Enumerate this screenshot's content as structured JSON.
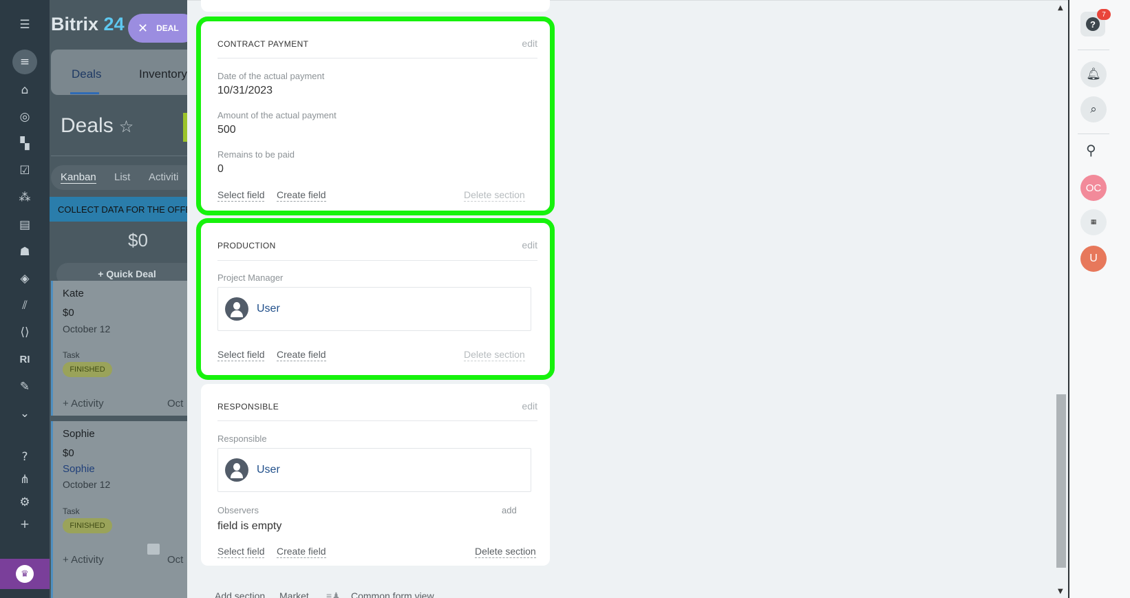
{
  "header": {
    "logo_word": "Bitrix",
    "logo_number": "24",
    "deal_pill_label": "DEAL"
  },
  "crm_tabs": {
    "deals": "Deals",
    "inventory": "Inventory"
  },
  "page_title": "Deals",
  "view_tabs": {
    "kanban": "Kanban",
    "list": "List",
    "activities": "Activiti"
  },
  "stage": {
    "label": "COLLECT DATA FOR THE OFFE",
    "sum": "$0",
    "quick_deal": "Quick Deal"
  },
  "cards": [
    {
      "name": "Kate",
      "amount": "$0",
      "date": "October 12",
      "task_label": "Task",
      "badge": "FINISHED",
      "activity": "+ Activity",
      "date_short": "Oct"
    },
    {
      "name": "Sophie",
      "amount": "$0",
      "contact": "Sophie",
      "date": "October 12",
      "task_label": "Task",
      "badge": "FINISHED",
      "activity": "+ Activity",
      "date_short": "Oct"
    }
  ],
  "rail": {
    "bottom_text": "RI"
  },
  "sections": {
    "contract_payment": {
      "title": "CONTRACT PAYMENT",
      "edit": "edit",
      "fields": [
        {
          "label": "Date of the actual payment",
          "value": "10/31/2023"
        },
        {
          "label": "Amount of the actual payment",
          "value": "500"
        },
        {
          "label": "Remains to be paid",
          "value": "0"
        }
      ],
      "select_field": "Select field",
      "create_field": "Create field",
      "delete_section": "Delete section"
    },
    "production": {
      "title": "PRODUCTION",
      "edit": "edit",
      "field_label": "Project Manager",
      "user_name": "User",
      "select_field": "Select field",
      "create_field": "Create field",
      "delete_section": "Delete section"
    },
    "responsible": {
      "title": "RESPONSIBLE",
      "edit": "edit",
      "field_label": "Responsible",
      "user_name": "User",
      "observers_label": "Observers",
      "observers_add": "add",
      "observers_value": "field is empty",
      "select_field": "Select field",
      "create_field": "Create field",
      "delete_section": "Delete section"
    }
  },
  "footer": {
    "add_section": "Add section",
    "market": "Market",
    "common_form_view": "Common form view"
  },
  "right_panel": {
    "help_count": "7",
    "avatar_oc": "OC",
    "avatar_u": "U"
  },
  "colors": {
    "highlight": "#16f20c",
    "rail": "#2c3a44",
    "link": "#1f4e8a"
  }
}
